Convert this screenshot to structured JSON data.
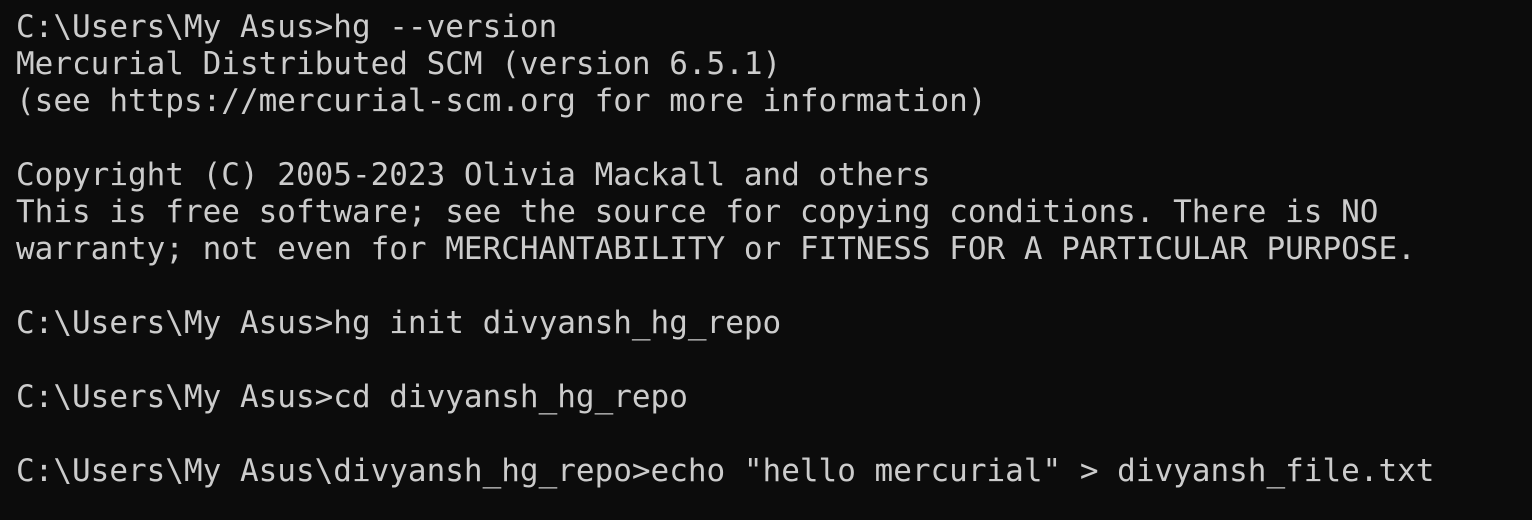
{
  "terminal": {
    "lines": [
      "C:\\Users\\My Asus>hg --version",
      "Mercurial Distributed SCM (version 6.5.1)",
      "(see https://mercurial-scm.org for more information)",
      "",
      "Copyright (C) 2005-2023 Olivia Mackall and others",
      "This is free software; see the source for copying conditions. There is NO",
      "warranty; not even for MERCHANTABILITY or FITNESS FOR A PARTICULAR PURPOSE.",
      "",
      "C:\\Users\\My Asus>hg init divyansh_hg_repo",
      "",
      "C:\\Users\\My Asus>cd divyansh_hg_repo",
      "",
      "C:\\Users\\My Asus\\divyansh_hg_repo>echo \"hello mercurial\" > divyansh_file.txt"
    ]
  },
  "colors": {
    "background": "#0c0c0c",
    "text": "#cccccc"
  }
}
